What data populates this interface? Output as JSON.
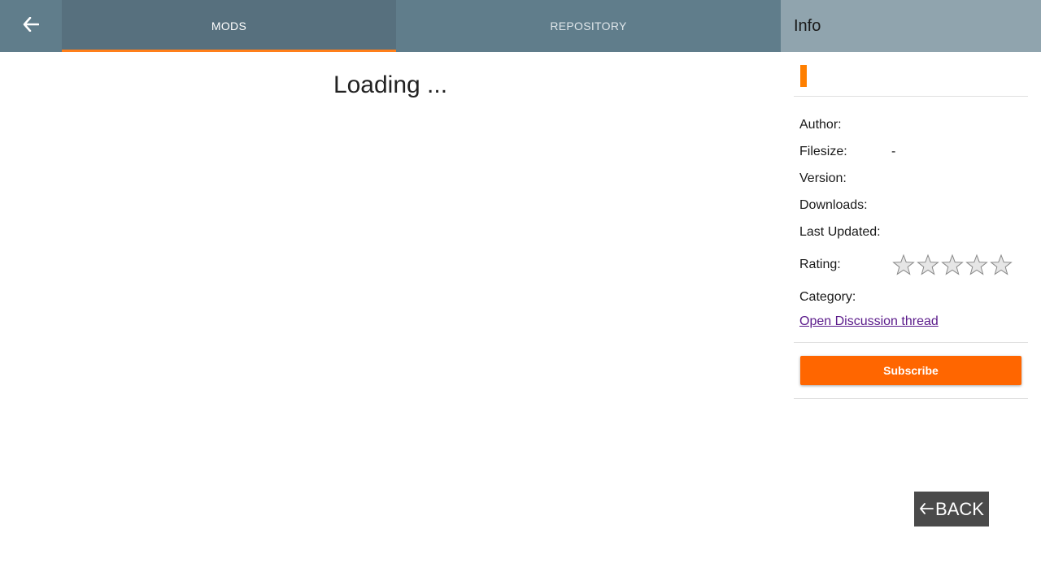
{
  "nav": {
    "back_icon": "arrow-left-icon",
    "tabs": [
      {
        "label": "MODS",
        "active": true
      },
      {
        "label": "REPOSITORY",
        "active": false
      }
    ]
  },
  "main": {
    "loading_text": "Loading ..."
  },
  "info": {
    "header": "Info",
    "fields": [
      {
        "label": "Author:",
        "value": ""
      },
      {
        "label": "Filesize:",
        "value": "-"
      },
      {
        "label": "Version:",
        "value": ""
      },
      {
        "label": "Downloads:",
        "value": ""
      },
      {
        "label": "Last Updated:",
        "value": ""
      }
    ],
    "rating_label": "Rating:",
    "rating_value": 0,
    "rating_max": 5,
    "category_label": "Category:",
    "category_value": "",
    "discussion_link": "Open Discussion thread",
    "subscribe_label": "Subscribe"
  },
  "footer": {
    "back_label": "BACK",
    "back_icon": "arrow-left-icon"
  },
  "colors": {
    "topbar": "#607d8b",
    "active_tab": "#57707e",
    "accent": "#ff7f1a",
    "info_header": "#90a4ae",
    "subscribe": "#ff6600",
    "back_button": "#4a4a4a"
  }
}
